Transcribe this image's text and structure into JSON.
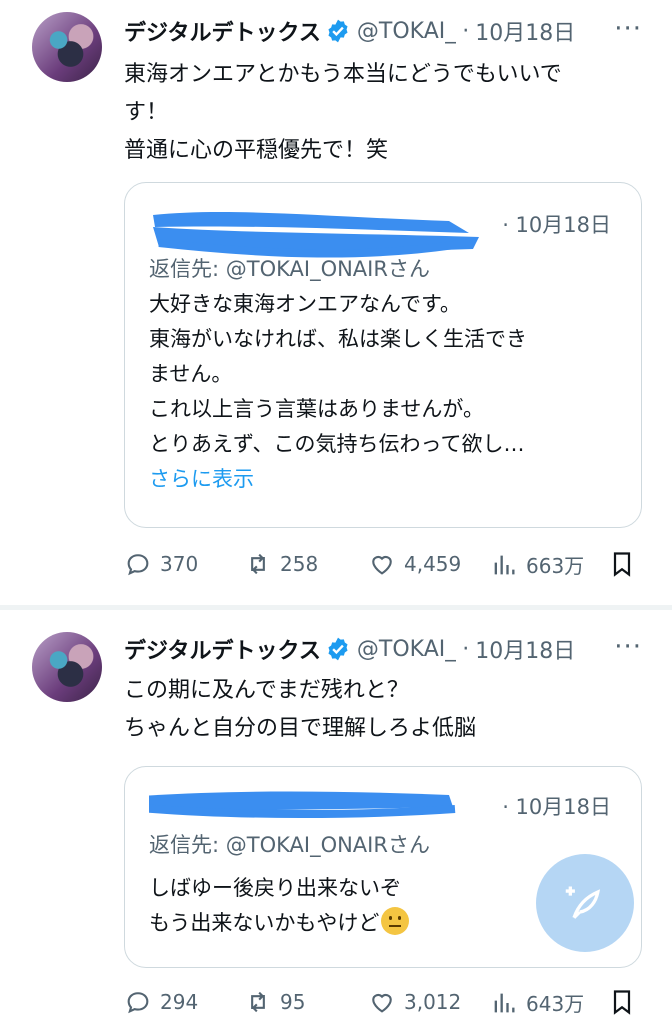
{
  "tweets": [
    {
      "author_name": "デジタルデトックス",
      "handle": "@TOKAI_",
      "separator": "·",
      "time": "10月18日",
      "more": "···",
      "text_lines": [
        "東海オンエアとかもう本当にどうでもいいで",
        "す！",
        "普通に心の平穏優先で！笑"
      ],
      "quote": {
        "time": "10月18日",
        "reply_to": "返信先: @TOKAI_ONAIRさん",
        "body_lines": [
          "大好きな東海オンエアなんです。",
          "東海がいなければ、私は楽しく生活でき",
          "ません。",
          "これ以上言う言葉はありませんが。",
          "とりあえず、この気持ち伝わって欲し…"
        ],
        "show_more": "さらに表示"
      },
      "stats": {
        "replies": "370",
        "retweets": "258",
        "likes": "4,459",
        "views": "663万"
      }
    },
    {
      "author_name": "デジタルデトックス",
      "handle": "@TOKAI_",
      "separator": "·",
      "time": "10月18日",
      "more": "···",
      "text_lines": [
        "この期に及んでまだ残れと？",
        "ちゃんと自分の目で理解しろよ低脳"
      ],
      "quote": {
        "time": "10月18日",
        "reply_to": "返信先: @TOKAI_ONAIRさん",
        "body_lines": [
          "しばゆー後戻り出来ないぞ",
          "もう出来ないかもやけど"
        ]
      },
      "stats": {
        "replies": "294",
        "retweets": "95",
        "likes": "3,012",
        "views": "643万"
      }
    }
  ],
  "colors": {
    "accent": "#1d9bf0",
    "muted": "#536471",
    "border": "#cfd9de",
    "redaction": "#3b8ef0"
  },
  "icons": [
    "verified-badge-icon",
    "more-icon",
    "reply-icon",
    "retweet-icon",
    "like-icon",
    "views-icon",
    "bookmark-icon",
    "compose-icon"
  ]
}
